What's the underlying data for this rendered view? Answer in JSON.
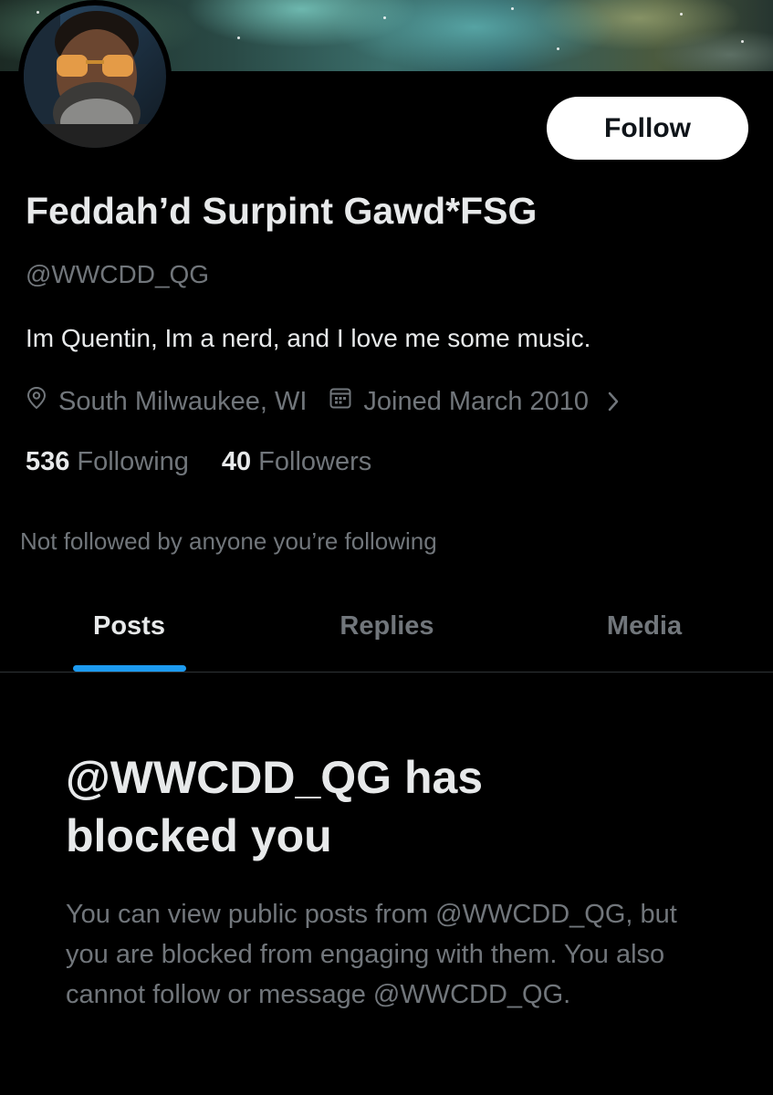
{
  "profile": {
    "display_name": "Feddah’d Surpint Gawd*FSG",
    "handle": "@WWCDD_QG",
    "bio": "Im Quentin, Im a nerd, and I love me some music.",
    "location": "South Milwaukee, WI",
    "joined": "Joined March 2010",
    "following_count": "536",
    "following_label": "Following",
    "followers_count": "40",
    "followers_label": "Followers",
    "not_followed_text": "Not followed by anyone you’re following"
  },
  "actions": {
    "follow_label": "Follow"
  },
  "tabs": [
    {
      "label": "Posts",
      "active": true
    },
    {
      "label": "Replies",
      "active": false
    },
    {
      "label": "Media",
      "active": false
    }
  ],
  "blocked": {
    "title": "@WWCDD_QG has blocked you",
    "description": "You can view public posts from @WWCDD_QG, but you are blocked from engaging with them. You also cannot follow or message @WWCDD_QG."
  },
  "icons": {
    "location": "location-pin-icon",
    "calendar": "calendar-icon",
    "chevron": "chevron-right-icon"
  },
  "colors": {
    "background": "#000000",
    "text_primary": "#e7e9ea",
    "text_secondary": "#71767b",
    "accent": "#1d9bf0",
    "follow_button_bg": "#ffffff",
    "divider": "#2f3336"
  }
}
